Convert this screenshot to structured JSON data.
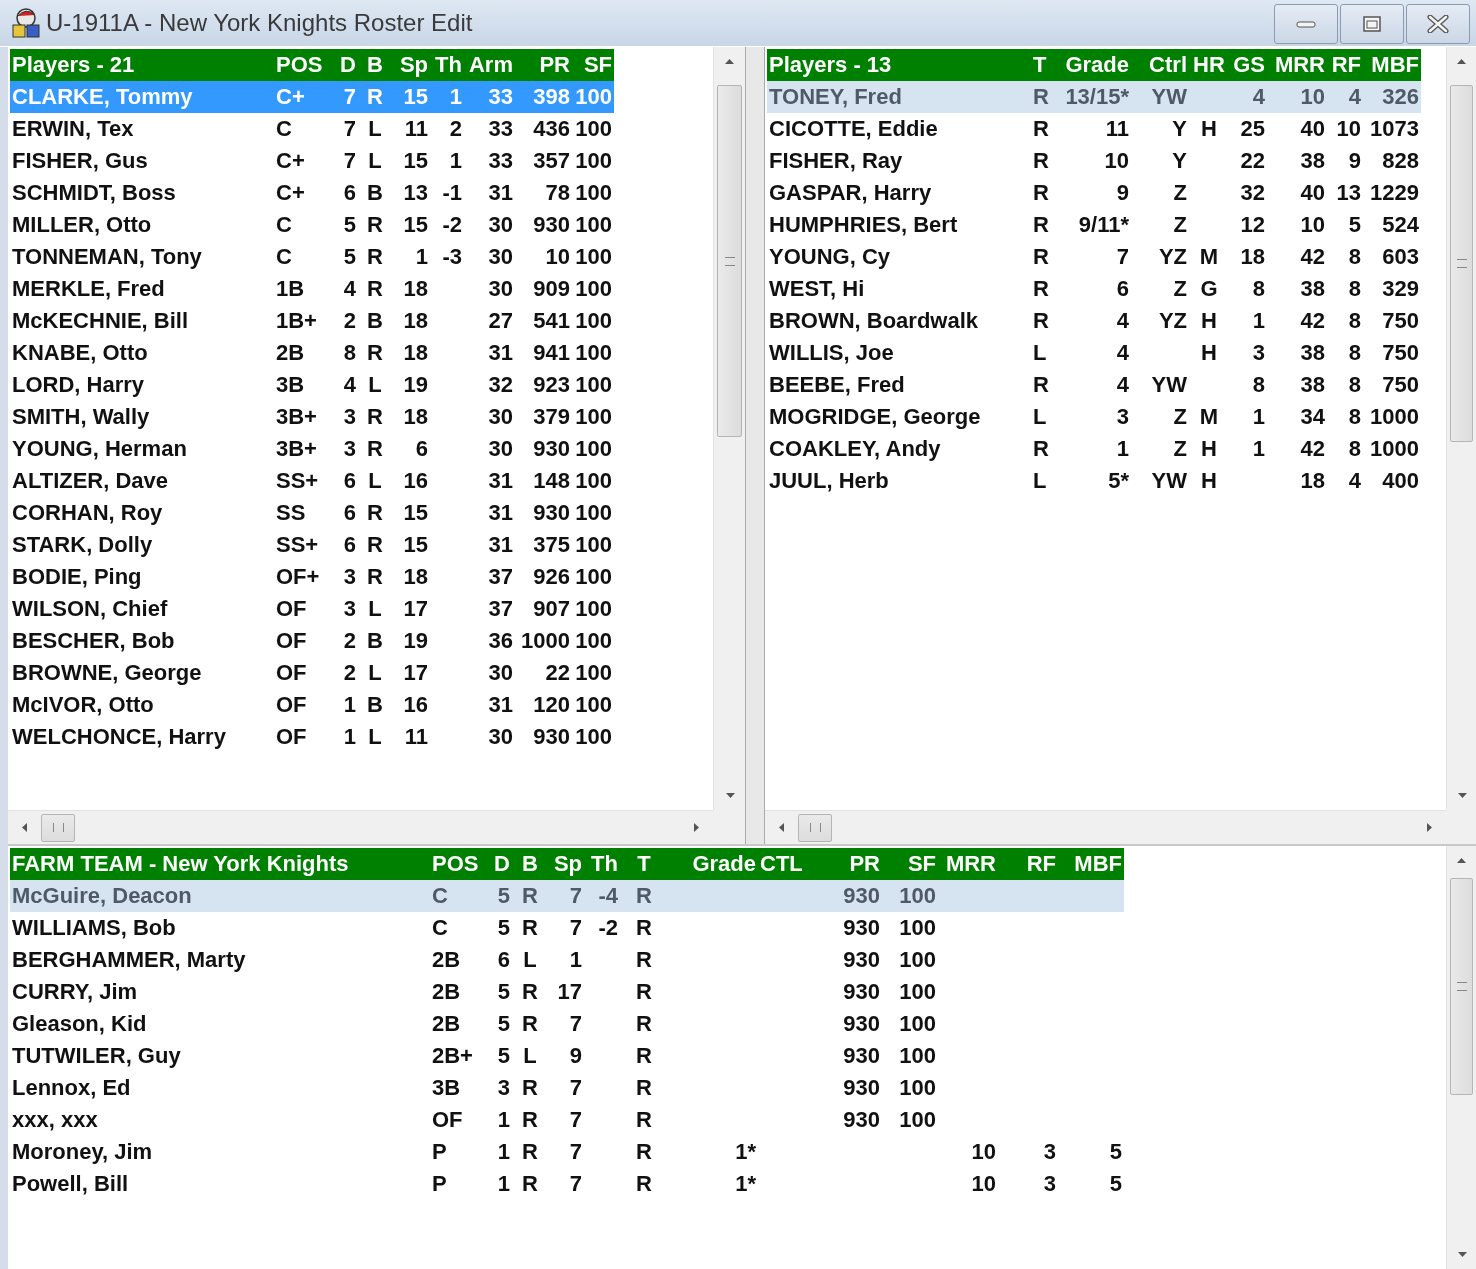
{
  "window": {
    "title": "U-1911A - New York Knights Roster Edit"
  },
  "roster_pane": {
    "focused": true,
    "columns": [
      "Players - 21",
      "POS",
      "D",
      "B",
      "Sp",
      "Th",
      "Arm",
      "PR",
      "SF"
    ],
    "rows": [
      {
        "selected": true,
        "cells": [
          "CLARKE, Tommy",
          "C+",
          "7",
          "R",
          "15",
          "1",
          "33",
          "398",
          "100"
        ]
      },
      {
        "selected": false,
        "cells": [
          "ERWIN, Tex",
          "C",
          "7",
          "L",
          "11",
          "2",
          "33",
          "436",
          "100"
        ]
      },
      {
        "selected": false,
        "cells": [
          "FISHER, Gus",
          "C+",
          "7",
          "L",
          "15",
          "1",
          "33",
          "357",
          "100"
        ]
      },
      {
        "selected": false,
        "cells": [
          "SCHMIDT, Boss",
          "C+",
          "6",
          "B",
          "13",
          "-1",
          "31",
          "78",
          "100"
        ]
      },
      {
        "selected": false,
        "cells": [
          "MILLER, Otto",
          "C",
          "5",
          "R",
          "15",
          "-2",
          "30",
          "930",
          "100"
        ]
      },
      {
        "selected": false,
        "cells": [
          "TONNEMAN, Tony",
          "C",
          "5",
          "R",
          "1",
          "-3",
          "30",
          "10",
          "100"
        ]
      },
      {
        "selected": false,
        "cells": [
          "MERKLE, Fred",
          "1B",
          "4",
          "R",
          "18",
          null,
          "30",
          "909",
          "100"
        ]
      },
      {
        "selected": false,
        "cells": [
          "McKECHNIE, Bill",
          "1B+",
          "2",
          "B",
          "18",
          null,
          "27",
          "541",
          "100"
        ]
      },
      {
        "selected": false,
        "cells": [
          "KNABE, Otto",
          "2B",
          "8",
          "R",
          "18",
          null,
          "31",
          "941",
          "100"
        ]
      },
      {
        "selected": false,
        "cells": [
          "LORD, Harry",
          "3B",
          "4",
          "L",
          "19",
          null,
          "32",
          "923",
          "100"
        ]
      },
      {
        "selected": false,
        "cells": [
          "SMITH, Wally",
          "3B+",
          "3",
          "R",
          "18",
          null,
          "30",
          "379",
          "100"
        ]
      },
      {
        "selected": false,
        "cells": [
          "YOUNG, Herman",
          "3B+",
          "3",
          "R",
          "6",
          null,
          "30",
          "930",
          "100"
        ]
      },
      {
        "selected": false,
        "cells": [
          "ALTIZER, Dave",
          "SS+",
          "6",
          "L",
          "16",
          null,
          "31",
          "148",
          "100"
        ]
      },
      {
        "selected": false,
        "cells": [
          "CORHAN, Roy",
          "SS",
          "6",
          "R",
          "15",
          null,
          "31",
          "930",
          "100"
        ]
      },
      {
        "selected": false,
        "cells": [
          "STARK, Dolly",
          "SS+",
          "6",
          "R",
          "15",
          null,
          "31",
          "375",
          "100"
        ]
      },
      {
        "selected": false,
        "cells": [
          "BODIE, Ping",
          "OF+",
          "3",
          "R",
          "18",
          null,
          "37",
          "926",
          "100"
        ]
      },
      {
        "selected": false,
        "cells": [
          "WILSON, Chief",
          "OF",
          "3",
          "L",
          "17",
          null,
          "37",
          "907",
          "100"
        ]
      },
      {
        "selected": false,
        "cells": [
          "BESCHER, Bob",
          "OF",
          "2",
          "B",
          "19",
          null,
          "36",
          "1000",
          "100"
        ]
      },
      {
        "selected": false,
        "cells": [
          "BROWNE, George",
          "OF",
          "2",
          "L",
          "17",
          null,
          "30",
          "22",
          "100"
        ]
      },
      {
        "selected": false,
        "cells": [
          "McIVOR, Otto",
          "OF",
          "1",
          "B",
          "16",
          null,
          "31",
          "120",
          "100"
        ]
      },
      {
        "selected": false,
        "cells": [
          "WELCHONCE, Harry",
          "OF",
          "1",
          "L",
          "11",
          null,
          "30",
          "930",
          "100"
        ]
      }
    ]
  },
  "pitchers_pane": {
    "focused": false,
    "columns": [
      "Players - 13",
      "T",
      "Grade",
      "Ctrl",
      "HR",
      "GS",
      "MRR",
      "RF",
      "MBF"
    ],
    "rows": [
      {
        "selected": true,
        "cells": [
          "TONEY, Fred",
          "R",
          "13/15*",
          "YW",
          null,
          "4",
          "10",
          "4",
          "326"
        ]
      },
      {
        "selected": false,
        "cells": [
          "CICOTTE, Eddie",
          "R",
          "11",
          "Y",
          "H",
          "25",
          "40",
          "10",
          "1073"
        ]
      },
      {
        "selected": false,
        "cells": [
          "FISHER, Ray",
          "R",
          "10",
          "Y",
          null,
          "22",
          "38",
          "9",
          "828"
        ]
      },
      {
        "selected": false,
        "cells": [
          "GASPAR, Harry",
          "R",
          "9",
          "Z",
          null,
          "32",
          "40",
          "13",
          "1229"
        ]
      },
      {
        "selected": false,
        "cells": [
          "HUMPHRIES, Bert",
          "R",
          "9/11*",
          "Z",
          null,
          "12",
          "10",
          "5",
          "524"
        ]
      },
      {
        "selected": false,
        "cells": [
          "YOUNG, Cy",
          "R",
          "7",
          "YZ",
          "M",
          "18",
          "42",
          "8",
          "603"
        ]
      },
      {
        "selected": false,
        "cells": [
          "WEST, Hi",
          "R",
          "6",
          "Z",
          "G",
          "8",
          "38",
          "8",
          "329"
        ]
      },
      {
        "selected": false,
        "cells": [
          "BROWN, Boardwalk",
          "R",
          "4",
          "YZ",
          "H",
          "1",
          "42",
          "8",
          "750"
        ]
      },
      {
        "selected": false,
        "cells": [
          "WILLIS, Joe",
          "L",
          "4",
          null,
          "H",
          "3",
          "38",
          "8",
          "750"
        ]
      },
      {
        "selected": false,
        "cells": [
          "BEEBE, Fred",
          "R",
          "4",
          "YW",
          null,
          "8",
          "38",
          "8",
          "750"
        ]
      },
      {
        "selected": false,
        "cells": [
          "MOGRIDGE, George",
          "L",
          "3",
          "Z",
          "M",
          "1",
          "34",
          "8",
          "1000"
        ]
      },
      {
        "selected": false,
        "cells": [
          "COAKLEY, Andy",
          "R",
          "1",
          "Z",
          "H",
          "1",
          "42",
          "8",
          "1000"
        ]
      },
      {
        "selected": false,
        "cells": [
          "JUUL, Herb",
          "L",
          "5*",
          "YW",
          "H",
          null,
          "18",
          "4",
          "400"
        ]
      }
    ]
  },
  "farm_pane": {
    "focused": false,
    "columns": [
      "FARM TEAM - New York Knights",
      "POS",
      "D",
      "B",
      "Sp",
      "Th",
      "T",
      "Grade",
      "CTL",
      "PR",
      "SF",
      "MRR",
      "RF",
      "MBF"
    ],
    "rows": [
      {
        "selected": true,
        "cells": [
          "McGuire, Deacon",
          "C",
          "5",
          "R",
          "7",
          "-4",
          "R",
          null,
          null,
          "930",
          "100",
          null,
          null,
          null
        ]
      },
      {
        "selected": false,
        "cells": [
          "WILLIAMS, Bob",
          "C",
          "5",
          "R",
          "7",
          "-2",
          "R",
          null,
          null,
          "930",
          "100",
          null,
          null,
          null
        ]
      },
      {
        "selected": false,
        "cells": [
          "BERGHAMMER, Marty",
          "2B",
          "6",
          "L",
          "1",
          null,
          "R",
          null,
          null,
          "930",
          "100",
          null,
          null,
          null
        ]
      },
      {
        "selected": false,
        "cells": [
          "CURRY, Jim",
          "2B",
          "5",
          "R",
          "17",
          null,
          "R",
          null,
          null,
          "930",
          "100",
          null,
          null,
          null
        ]
      },
      {
        "selected": false,
        "cells": [
          "Gleason, Kid",
          "2B",
          "5",
          "R",
          "7",
          null,
          "R",
          null,
          null,
          "930",
          "100",
          null,
          null,
          null
        ]
      },
      {
        "selected": false,
        "cells": [
          "TUTWILER, Guy",
          "2B+",
          "5",
          "L",
          "9",
          null,
          "R",
          null,
          null,
          "930",
          "100",
          null,
          null,
          null
        ]
      },
      {
        "selected": false,
        "cells": [
          "Lennox, Ed",
          "3B",
          "3",
          "R",
          "7",
          null,
          "R",
          null,
          null,
          "930",
          "100",
          null,
          null,
          null
        ]
      },
      {
        "selected": false,
        "cells": [
          "xxx, xxx",
          "OF",
          "1",
          "R",
          "7",
          null,
          "R",
          null,
          null,
          "930",
          "100",
          null,
          null,
          null
        ]
      },
      {
        "selected": false,
        "cells": [
          "Moroney, Jim",
          "P",
          "1",
          "R",
          "7",
          null,
          "R",
          "1*",
          null,
          null,
          null,
          "10",
          "3",
          "5"
        ]
      },
      {
        "selected": false,
        "cells": [
          "Powell, Bill",
          "P",
          "1",
          "R",
          "7",
          null,
          "R",
          "1*",
          null,
          null,
          null,
          "10",
          "3",
          "5"
        ]
      }
    ]
  }
}
